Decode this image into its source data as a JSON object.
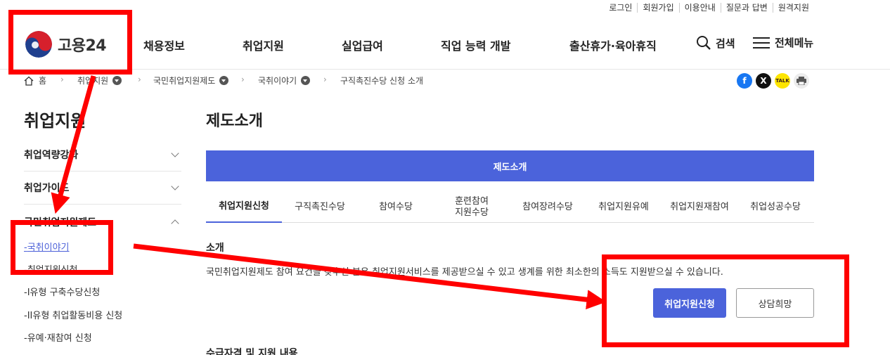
{
  "utility_links": [
    "로그인",
    "회원가입",
    "이용안내",
    "질문과 답변",
    "원격지원"
  ],
  "logo": {
    "text": "고용24"
  },
  "gnb": [
    "채용정보",
    "취업지원",
    "실업급여",
    "직업 능력 개발",
    "출산휴가·육아휴직"
  ],
  "tools": {
    "search": "검색",
    "menu": "전체메뉴"
  },
  "breadcrumb": {
    "home": "홈",
    "items": [
      "취업지원",
      "국민취업지원제도",
      "국취이야기",
      "구직촉진수당 신청 소개"
    ]
  },
  "share": {
    "kakao": "TALK"
  },
  "lnb": {
    "title": "취업지원",
    "groups": [
      "취업역량강화",
      "취업가이드",
      "국민취업지원제도"
    ],
    "subs": [
      "국취이야기",
      "취업지원신청",
      "I유형 구축수당신청",
      "II유형 취업활동비용 신청",
      "유예·재참여 신청"
    ]
  },
  "content": {
    "title": "제도소개",
    "band": "제도소개",
    "tabs": [
      "취업지원신청",
      "구직촉진수당",
      "참여수당",
      "훈련참여\n지원수당",
      "참여장려수당",
      "취업지원유예",
      "취업지원재참여",
      "취업성공수당"
    ],
    "section_title": "소개",
    "description": "국민취업지원제도 참여 요건을 갖추신 분은 취업지원서비스를 제공받으실 수 있고 생계를 위한 최소한의 소득도 지원받으실 수 있습니다.",
    "btn_apply": "취업지원신청",
    "btn_consult": "상담희망",
    "section2_title": "수급자격 및 지원 내용"
  },
  "colors": {
    "brand_blue": "#4b63db",
    "annotation_red": "#ff0000"
  }
}
